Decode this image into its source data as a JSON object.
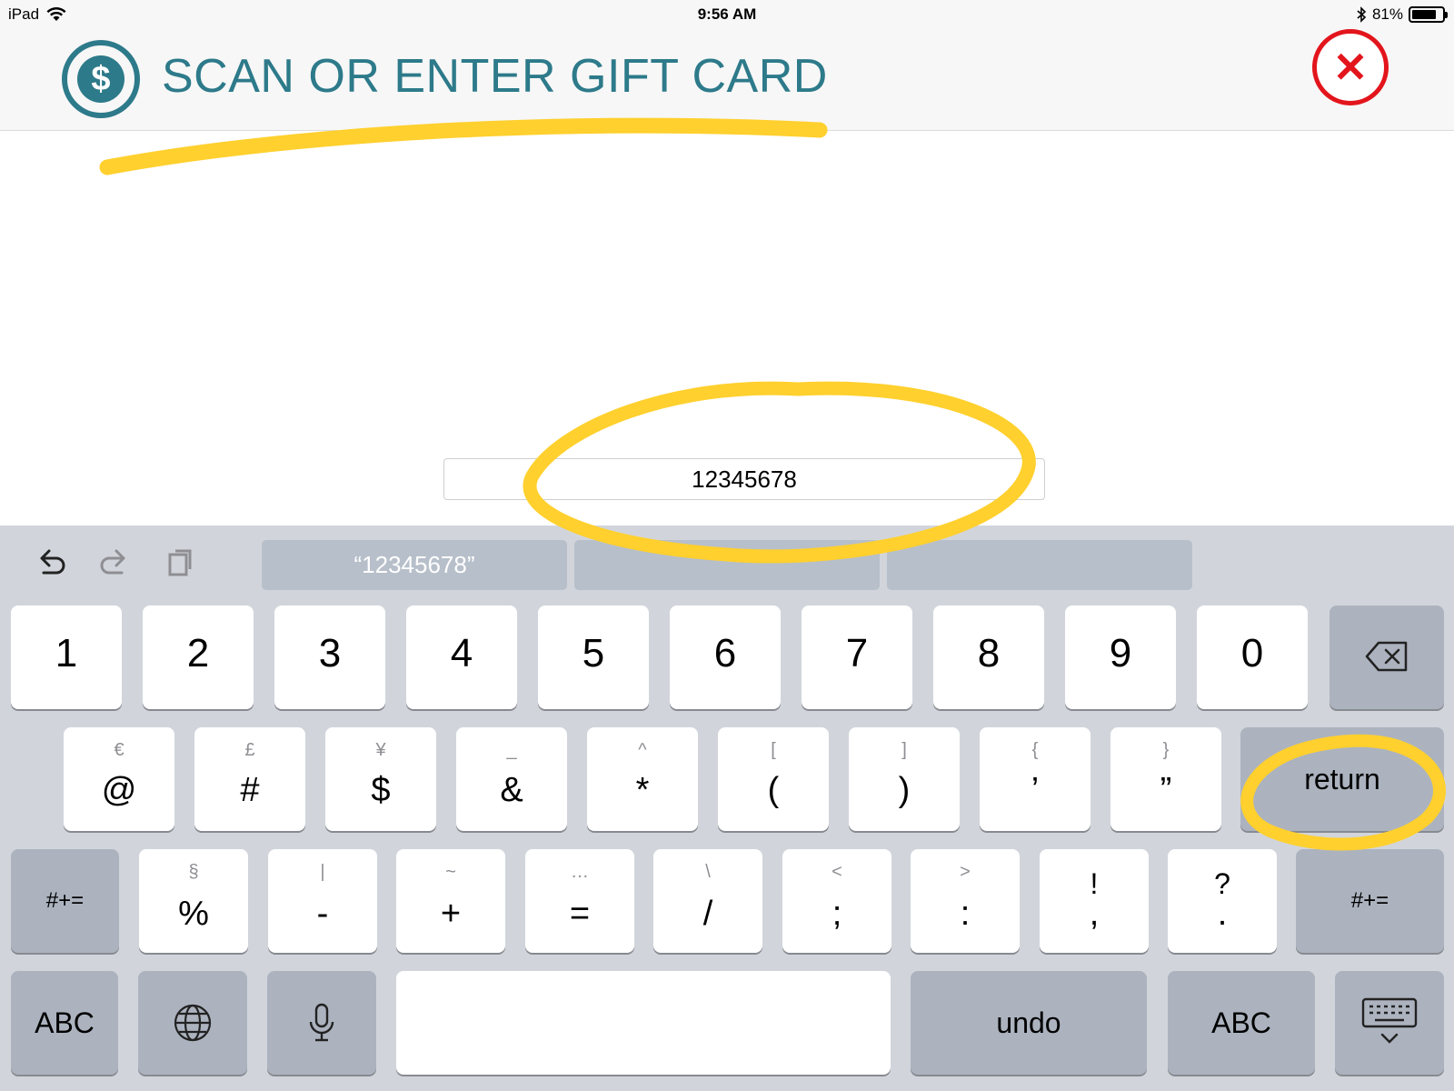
{
  "status_bar": {
    "device": "iPad",
    "time": "9:56 AM",
    "battery_text": "81%",
    "battery_level": 0.81
  },
  "header": {
    "title": "SCAN OR ENTER GIFT CARD",
    "dollar_symbol": "$",
    "close_symbol": "✕"
  },
  "input": {
    "value": "12345678"
  },
  "keyboard": {
    "suggestions": [
      "“12345678”",
      "",
      ""
    ],
    "row1": [
      "1",
      "2",
      "3",
      "4",
      "5",
      "6",
      "7",
      "8",
      "9",
      "0"
    ],
    "row2": [
      {
        "alt": "€",
        "main": "@"
      },
      {
        "alt": "£",
        "main": "#"
      },
      {
        "alt": "¥",
        "main": "$"
      },
      {
        "alt": "_",
        "main": "&"
      },
      {
        "alt": "^",
        "main": "*"
      },
      {
        "alt": "[",
        "main": "("
      },
      {
        "alt": "]",
        "main": ")"
      },
      {
        "alt": "{",
        "main": "’"
      },
      {
        "alt": "}",
        "main": "”"
      }
    ],
    "row3": [
      {
        "alt": "§",
        "main": "%"
      },
      {
        "alt": "|",
        "main": "-"
      },
      {
        "alt": "~",
        "main": "+"
      },
      {
        "alt": "…",
        "main": "="
      },
      {
        "alt": "\\",
        "main": "/"
      },
      {
        "alt": "<",
        "main": ";"
      },
      {
        "alt": ">",
        "main": ":"
      },
      {
        "alt": "!",
        "main": ","
      },
      {
        "alt": "?",
        "main": "."
      }
    ],
    "return_label": "return",
    "shift_symbols_label": "#+=",
    "abc_label": "ABC",
    "undo_label": "undo"
  },
  "colors": {
    "accent": "#2d7a8a",
    "close": "#e3151c",
    "highlight": "#ffd02e",
    "keyboard_bg": "#d1d5db"
  },
  "icons": [
    "dollar-icon",
    "close-icon",
    "undo-icon",
    "redo-icon",
    "paste-icon",
    "backspace-icon",
    "globe-icon",
    "microphone-icon",
    "hide-keyboard-icon",
    "wifi-icon",
    "bluetooth-icon"
  ]
}
